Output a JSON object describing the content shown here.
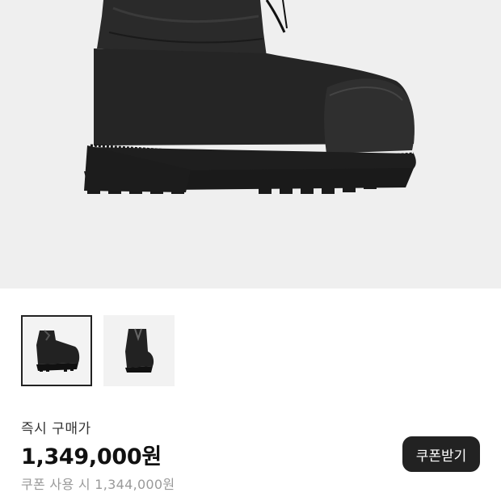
{
  "product": {
    "hero_image": "black-padded-boot",
    "thumbnails": [
      {
        "image": "boot-side-view",
        "selected": true
      },
      {
        "image": "boot-front-view",
        "selected": false
      }
    ]
  },
  "pricing": {
    "label": "즉시 구매가",
    "price": "1,349,000원",
    "coupon_price": "쿠폰 사용 시 1,344,000원"
  },
  "coupon_button": {
    "label": "쿠폰받기"
  },
  "colors": {
    "background": "#efefef",
    "button": "#222222",
    "muted_text": "#9a9a9a"
  }
}
